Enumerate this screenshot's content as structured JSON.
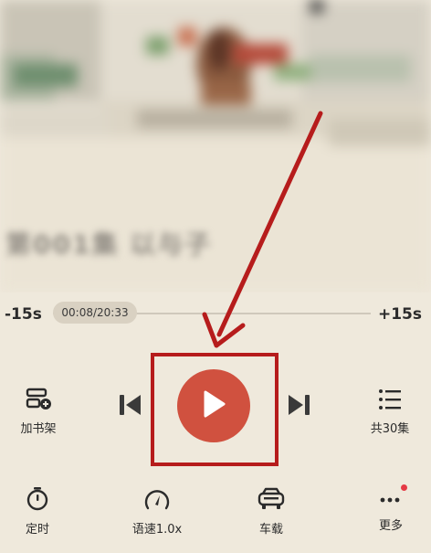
{
  "cover": {
    "title": "第001集 以与子"
  },
  "progress": {
    "skip_back_label": "-15s",
    "skip_forward_label": "+15s",
    "time_label": "00:08/20:33",
    "current": "00:08",
    "total": "20:33"
  },
  "controls": {
    "bookshelf_label": "加书架",
    "episodes_label": "共30集"
  },
  "bottom_bar": {
    "timer_label": "定时",
    "speed_label": "语速1.0x",
    "car_label": "车载",
    "more_label": "更多"
  },
  "colors": {
    "background": "#efe9dc",
    "play_button": "#d0513f",
    "annotation": "#b61c1c",
    "text": "#2b2b2b",
    "badge_dot": "#e53a45"
  },
  "icons": {
    "bookshelf": "add-bookshelf-icon",
    "prev": "skip-previous-icon",
    "play": "play-icon",
    "next": "skip-next-icon",
    "episodes": "episode-list-icon",
    "timer": "timer-icon",
    "speed": "speed-gauge-icon",
    "car": "car-icon",
    "more": "more-dots-icon"
  }
}
